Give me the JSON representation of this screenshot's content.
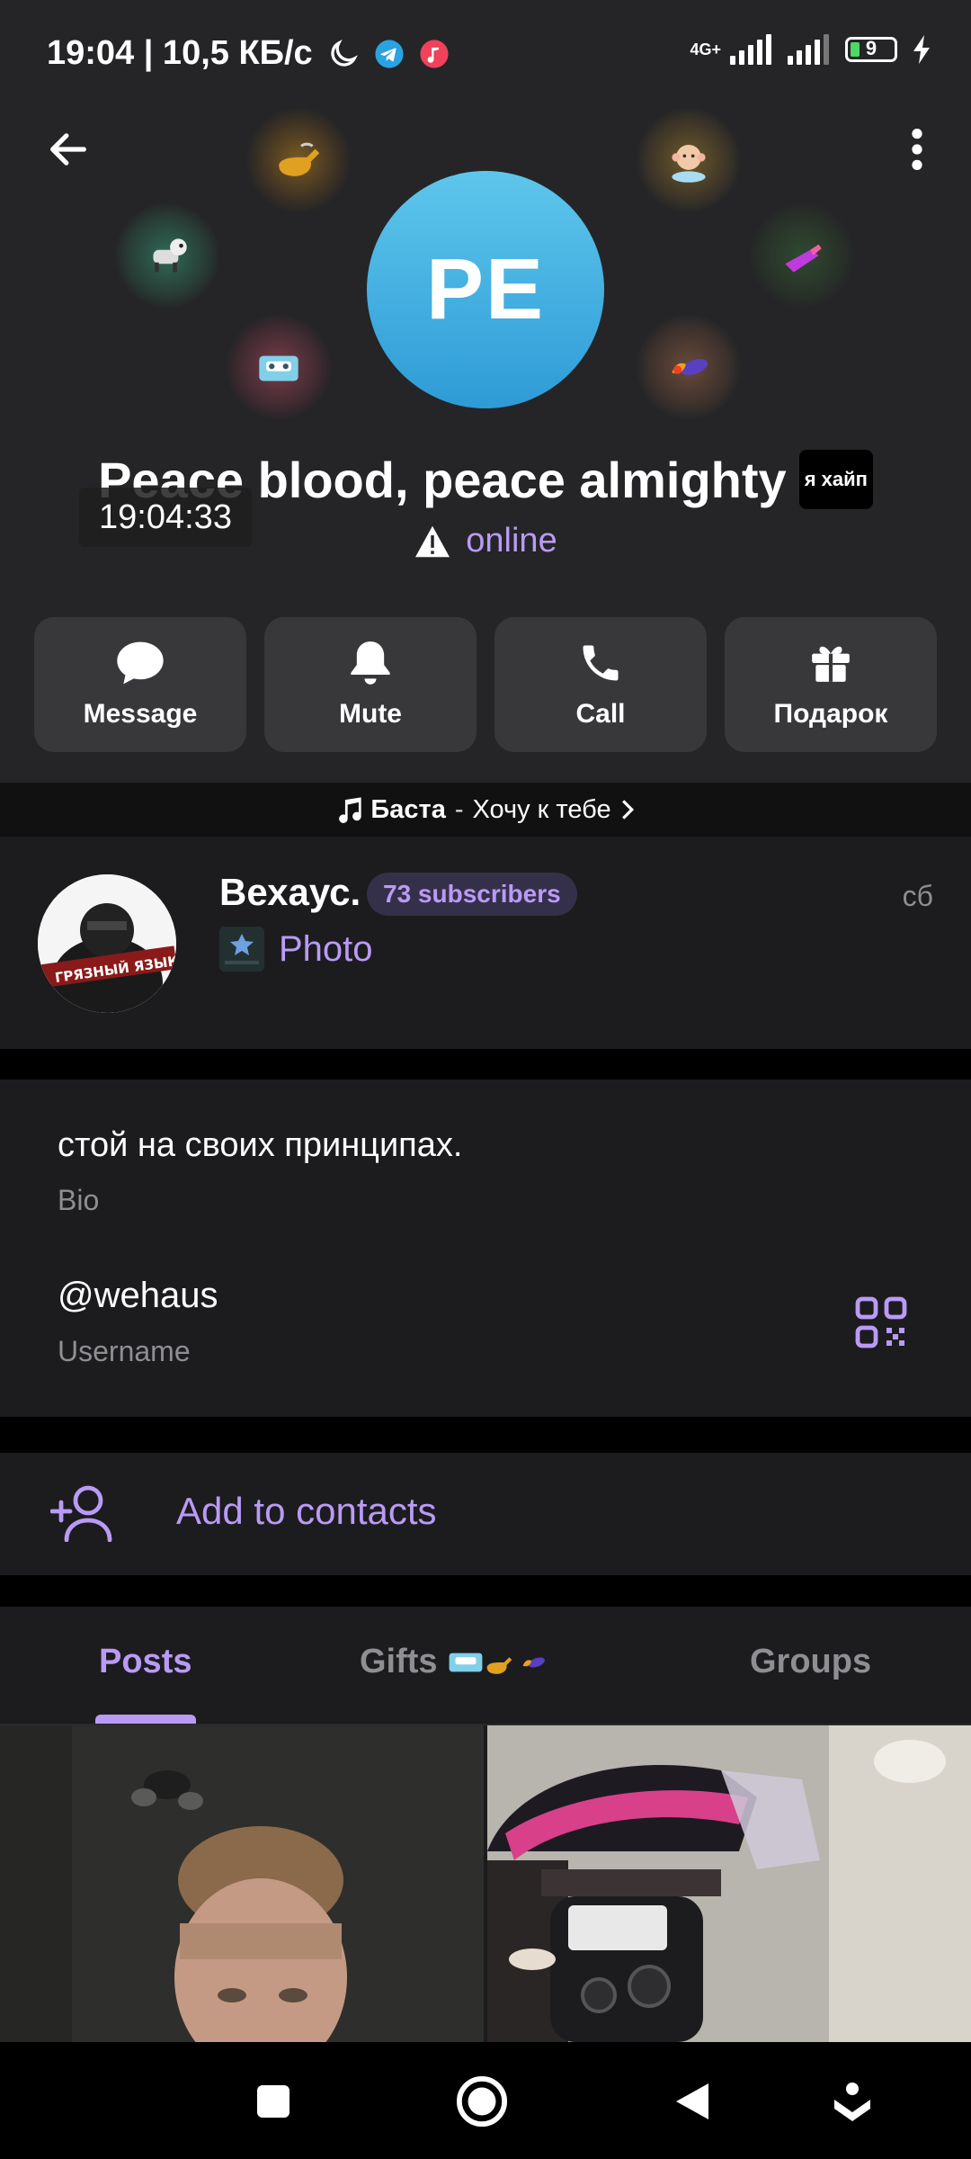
{
  "status_bar": {
    "time_speed": "19:04 | 10,5 КБ/с",
    "network": "4G+",
    "battery": "9"
  },
  "profile": {
    "avatar_initials": "PE",
    "name": "Peace blood, peace almighty",
    "badge": "я хайп",
    "time_overlay": "19:04:33",
    "status": "online"
  },
  "gift_icons": [
    "pipe-gift-icon",
    "robot-dog-gift-icon",
    "cassette-gift-icon",
    "monkey-gift-icon",
    "lipstick-gift-icon",
    "rocket-gift-icon"
  ],
  "actions": [
    {
      "label": "Message",
      "icon": "message-icon"
    },
    {
      "label": "Mute",
      "icon": "bell-icon"
    },
    {
      "label": "Call",
      "icon": "phone-icon"
    },
    {
      "label": "Подарок",
      "icon": "gift-icon"
    }
  ],
  "music": {
    "artist": "Баста",
    "separator": "-",
    "track": "Хочу к тебе"
  },
  "channel": {
    "name": "Вехаус.",
    "subscribers": "73 subscribers",
    "last_post": "Photo",
    "date": "сб",
    "avatar_text": "ГРЯЗНЫЙ ЯЗЫК"
  },
  "info": {
    "bio": "стой на своих принципах.",
    "bio_label": "Bio",
    "username": "@wehaus",
    "username_label": "Username"
  },
  "contacts": {
    "label": "Add to contacts"
  },
  "tabs": {
    "posts": "Posts",
    "gifts": "Gifts",
    "groups": "Groups",
    "active": "Posts"
  },
  "colors": {
    "accent": "#b99bf5",
    "avatar_top": "#5ec6ec",
    "avatar_bottom": "#2e9bd6",
    "background": "#1c1c1e"
  }
}
